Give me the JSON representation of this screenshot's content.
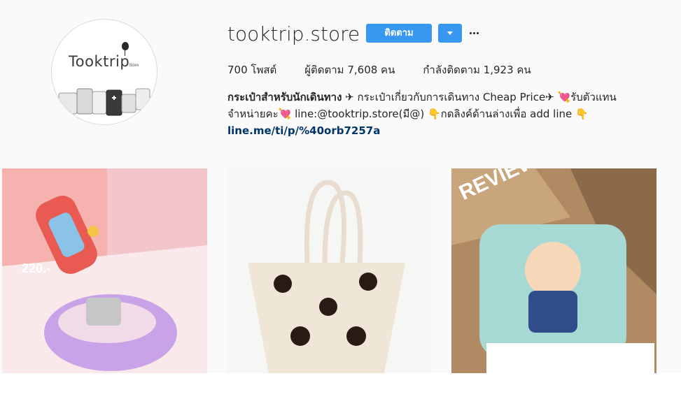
{
  "profile": {
    "username": "tooktrip.store",
    "avatar_text": "Tooktrip",
    "avatar_subtext": "Store",
    "follow_label": "ติดตาม",
    "stats": {
      "posts": "700 โพสต์",
      "followers": "ผู้ติดตาม 7,608 คน",
      "following": "กำลังติดตาม 1,923 คน"
    },
    "bio": {
      "name": "กระเป๋าสำหรับนักเดินทาง",
      "line1_rest": " ✈ กระเป๋าเกี่ยวกับการเดินทาง Cheap Price✈ 💘รับตัวแทน",
      "line2": "จำหน่ายคะ💘 line:@tooktrip.store(มี@) 👇กดลิงค์ด้านล่างเพื่อ add line 👇",
      "link": "line.me/ti/p/%40orb7257a"
    }
  },
  "posts": [
    {
      "price_label": "220.-"
    },
    {},
    {
      "review_label": "REVIEW"
    }
  ],
  "colors": {
    "accent": "#3897f0",
    "link": "#003569",
    "background": "#fafafa"
  }
}
